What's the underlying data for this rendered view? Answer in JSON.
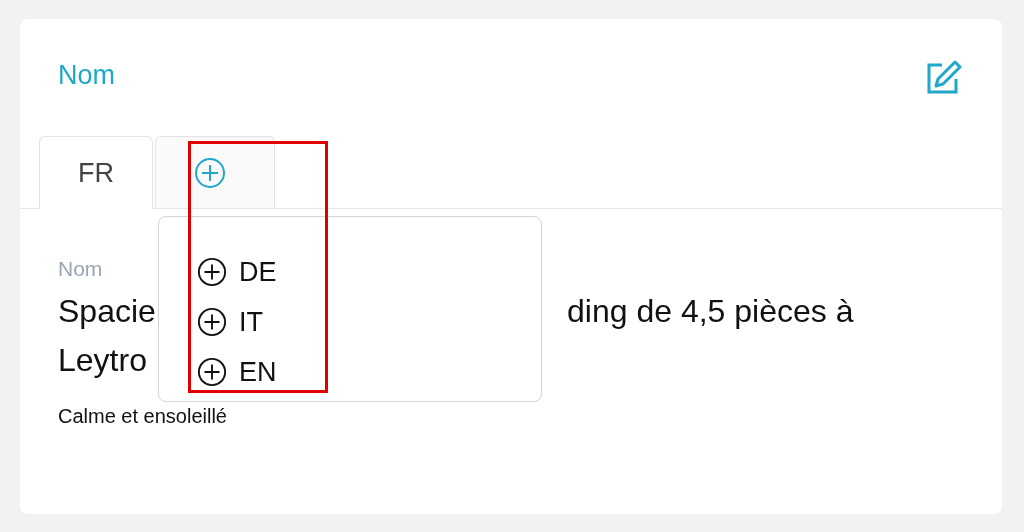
{
  "card": {
    "title": "Nom"
  },
  "tabs": [
    {
      "kind": "text",
      "label": "FR",
      "selected": true
    },
    {
      "kind": "add",
      "selected": false
    }
  ],
  "language_menu": {
    "items": [
      {
        "label": "DE"
      },
      {
        "label": "IT"
      },
      {
        "label": "EN"
      }
    ]
  },
  "field": {
    "label": "Nom",
    "value_lines": [
      {
        "left": "Spacie",
        "right": "ding de 4,5 pièces à"
      },
      {
        "left": "Leytro"
      }
    ],
    "note": "Calme et ensoleillé"
  }
}
